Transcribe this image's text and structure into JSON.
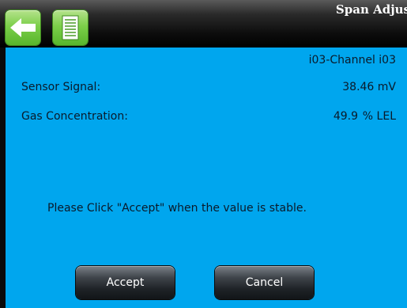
{
  "header": {
    "title": "Span Adjus",
    "back_icon": "arrow-left-icon",
    "document_icon": "document-icon"
  },
  "channel": {
    "name": "i03-Channel i03"
  },
  "readings": {
    "sensor_signal_label": "Sensor Signal:",
    "sensor_signal_value": "38.46 mV",
    "gas_concentration_label": "Gas Concentration:",
    "gas_concentration_value": "49.9",
    "gas_concentration_unit": "% LEL"
  },
  "instruction": "Please Click \"Accept\" when the value is stable.",
  "buttons": {
    "accept_label": "Accept",
    "cancel_label": "Cancel"
  },
  "colors": {
    "content_background": "#00a6ee",
    "header_background": "#000000",
    "toolbar_button_green": "#7ccf4a",
    "action_button_dark": "#2a2e33"
  }
}
